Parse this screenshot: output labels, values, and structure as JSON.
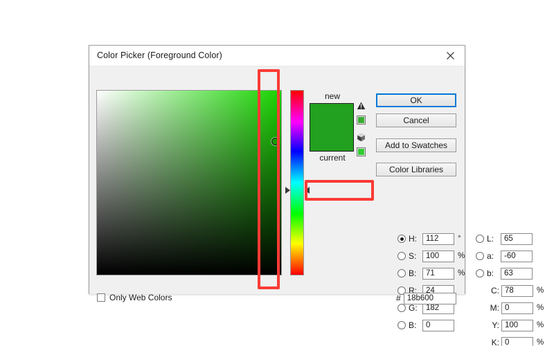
{
  "window": {
    "title": "Color Picker (Foreground Color)",
    "close_icon": "close-icon"
  },
  "preview": {
    "new_label": "new",
    "current_label": "current",
    "new_color": "#22a01f",
    "current_color": "#22a01f",
    "gamut_warning_icon": "out-of-gamut-warning-icon",
    "gamut_warning_swatch": "#3aac32",
    "web_warning_icon": "not-web-safe-warning-icon",
    "web_warning_swatch": "#33cc33"
  },
  "buttons": {
    "ok": "OK",
    "cancel": "Cancel",
    "add_to_swatches": "Add to Swatches",
    "color_libraries": "Color Libraries"
  },
  "options": {
    "only_web_colors": "Only Web Colors",
    "only_web_colors_checked": false
  },
  "hsb": [
    {
      "name": "hue",
      "label": "H:",
      "value": "112",
      "unit": "°",
      "selected": true
    },
    {
      "name": "saturation",
      "label": "S:",
      "value": "100",
      "unit": "%",
      "selected": false
    },
    {
      "name": "brightness",
      "label": "B:",
      "value": "71",
      "unit": "%",
      "selected": false
    }
  ],
  "rgb": [
    {
      "name": "red",
      "label": "R:",
      "value": "24",
      "unit": "",
      "selected": false
    },
    {
      "name": "green",
      "label": "G:",
      "value": "182",
      "unit": "",
      "selected": false
    },
    {
      "name": "blue",
      "label": "B:",
      "value": "0",
      "unit": "",
      "selected": false
    }
  ],
  "lab": [
    {
      "name": "lightness",
      "label": "L:",
      "value": "65",
      "unit": "",
      "selected": false
    },
    {
      "name": "a-axis",
      "label": "a:",
      "value": "-60",
      "unit": "",
      "selected": false
    },
    {
      "name": "b-axis",
      "label": "b:",
      "value": "63",
      "unit": "",
      "selected": false
    }
  ],
  "cmyk": [
    {
      "name": "cyan",
      "label": "C:",
      "value": "78",
      "unit": "%"
    },
    {
      "name": "magenta",
      "label": "M:",
      "value": "0",
      "unit": "%"
    },
    {
      "name": "yellow",
      "label": "Y:",
      "value": "100",
      "unit": "%"
    },
    {
      "name": "black",
      "label": "K:",
      "value": "0",
      "unit": "%"
    }
  ],
  "hex": {
    "symbol": "#",
    "value": "18b600"
  },
  "field": {
    "hue_base_color": "#18d400"
  },
  "annotations": {
    "highlight_color": "#fb3b35",
    "regions": [
      "color-field-right-edge",
      "saturation-row"
    ]
  }
}
